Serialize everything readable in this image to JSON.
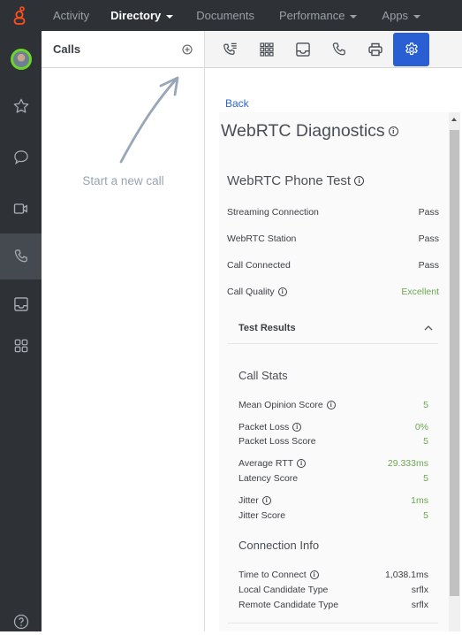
{
  "topbar": {
    "nav": [
      {
        "label": "Activity",
        "active": false,
        "dropdown": false
      },
      {
        "label": "Directory",
        "active": true,
        "dropdown": true
      },
      {
        "label": "Documents",
        "active": false,
        "dropdown": false
      },
      {
        "label": "Performance",
        "active": false,
        "dropdown": true
      },
      {
        "label": "Apps",
        "active": false,
        "dropdown": true
      }
    ],
    "brand_color": "#ff4f1f"
  },
  "leftrail": {
    "items": [
      {
        "icon": "avatar"
      },
      {
        "icon": "star-icon"
      },
      {
        "icon": "chat-icon"
      },
      {
        "icon": "video-icon"
      },
      {
        "icon": "phone-icon",
        "active": true
      },
      {
        "icon": "inbox-icon"
      },
      {
        "icon": "apps-icon"
      }
    ],
    "help_icon": "help-icon"
  },
  "calls": {
    "title": "Calls",
    "add_icon": "add-circle-icon",
    "empty_hint": "Start a new call"
  },
  "toolbar": {
    "buttons": [
      {
        "icon": "call-history-icon"
      },
      {
        "icon": "dialpad-icon"
      },
      {
        "icon": "voicemail-inbox-icon"
      },
      {
        "icon": "phone-icon"
      },
      {
        "icon": "print-icon"
      },
      {
        "icon": "settings-icon",
        "active": true
      }
    ],
    "accent": "#2a5fd3"
  },
  "diagnostics": {
    "back_label": "Back",
    "title": "WebRTC Diagnostics",
    "phone_test_title": "WebRTC Phone Test",
    "checks": [
      {
        "label": "Streaming Connection",
        "value": "Pass",
        "info": false,
        "green": false
      },
      {
        "label": "WebRTC Station",
        "value": "Pass",
        "info": false,
        "green": false
      },
      {
        "label": "Call Connected",
        "value": "Pass",
        "info": false,
        "green": false
      },
      {
        "label": "Call Quality",
        "value": "Excellent",
        "info": true,
        "green": true
      }
    ],
    "test_results_label": "Test Results",
    "call_stats_title": "Call Stats",
    "call_stats": [
      {
        "label": "Mean Opinion Score",
        "value": "5",
        "info": true
      },
      {
        "label": "Packet Loss",
        "value": "0%",
        "info": true
      },
      {
        "label": "Packet Loss Score",
        "value": "5",
        "info": false
      },
      {
        "label": "Average RTT",
        "value": "29.333ms",
        "info": true
      },
      {
        "label": "Latency Score",
        "value": "5",
        "info": false
      },
      {
        "label": "Jitter",
        "value": "1ms",
        "info": true
      },
      {
        "label": "Jitter Score",
        "value": "5",
        "info": false
      }
    ],
    "connection_info_title": "Connection Info",
    "connection_info": [
      {
        "label": "Time to Connect",
        "value": "1,038.1ms",
        "info": true
      },
      {
        "label": "Local Candidate Type",
        "value": "srflx",
        "info": false
      },
      {
        "label": "Remote Candidate Type",
        "value": "srflx",
        "info": false
      }
    ],
    "good_color": "#6aa84f"
  }
}
